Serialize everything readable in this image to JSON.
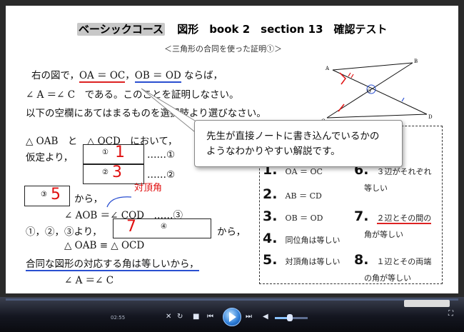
{
  "header": {
    "course": "ベーシックコース",
    "rest": "図形　book 2　section 13　確認テスト",
    "subtitle": "＜三角形の合同を使った証明①＞"
  },
  "problem": {
    "line1_a": "右の図で，",
    "line1_b": "OA ＝ OC",
    "line1_c": "，",
    "line1_d": "OB ＝ OD",
    "line1_e": "ならば，",
    "line2": "∠ A ＝∠ C　である。このことを証明しなさい。",
    "line3": "以下の空欄にあてはまるものを選択肢より選びなさい。"
  },
  "proof": {
    "line_a": "△ OAB　と　△ OCD　において，",
    "assume": "仮定より，",
    "blank1": "①",
    "blank1_ans": "1",
    "dots1": "……①",
    "blank2": "②",
    "blank2_ans": "3",
    "dots2": "……②",
    "blank3": "③",
    "blank3_ans": "5",
    "kara": "から，",
    "vertical_note": "対頂角",
    "angle_eq": "∠ AOB ＝∠ COD　……③",
    "from123": "①，②，③より，",
    "blank4": "④",
    "blank4_ans": "7",
    "kara2": "から，",
    "congruent": "△ OAB ≡ △ OCD",
    "conclusion": "合同な図形の対応する角は等しいから，",
    "final": "∠ A ＝∠ C"
  },
  "choices": [
    {
      "num": "1.",
      "text": "OA ＝ OC"
    },
    {
      "num": "2.",
      "text": "AB ＝ CD"
    },
    {
      "num": "3.",
      "text": "OB ＝ OD"
    },
    {
      "num": "4.",
      "text": "同位角は等しい"
    },
    {
      "num": "5.",
      "text": "対頂角は等しい"
    },
    {
      "num": "6.",
      "text": "３辺がそれぞれ",
      "text2": "等しい"
    },
    {
      "num": "7.",
      "text": "２辺とその間の",
      "text2": "角が等しい"
    },
    {
      "num": "8.",
      "text": "１辺とその両端",
      "text2": "の角が等しい"
    }
  ],
  "figure": {
    "labels": [
      "A",
      "B",
      "O",
      "C",
      "D"
    ]
  },
  "callout": {
    "line1": "先生が直接ノートに書き込んでいるかの",
    "line2": "ようなわかりやすい解説です。"
  },
  "player": {
    "time": "02:55",
    "progress": 0.0,
    "volume": 0.45,
    "accent": "#2b7bd6"
  }
}
